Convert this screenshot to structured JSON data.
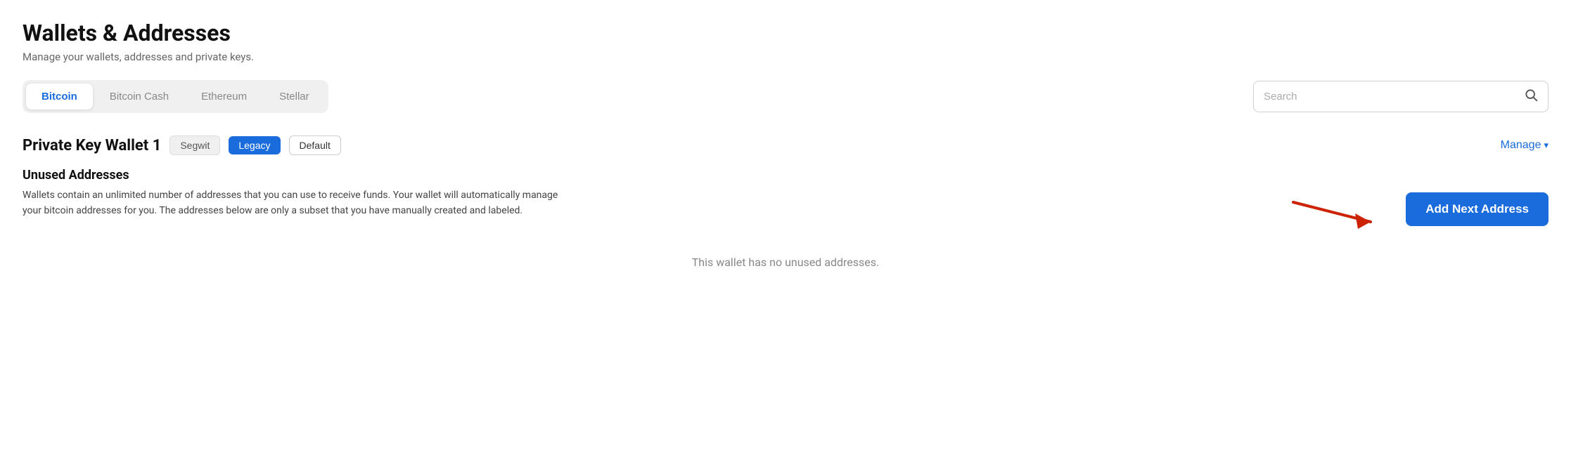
{
  "page": {
    "title": "Wallets & Addresses",
    "subtitle": "Manage your wallets, addresses and private keys."
  },
  "tabs": [
    {
      "id": "bitcoin",
      "label": "Bitcoin",
      "active": true
    },
    {
      "id": "bitcoin-cash",
      "label": "Bitcoin Cash",
      "active": false
    },
    {
      "id": "ethereum",
      "label": "Ethereum",
      "active": false
    },
    {
      "id": "stellar",
      "label": "Stellar",
      "active": false
    }
  ],
  "search": {
    "placeholder": "Search"
  },
  "wallet": {
    "name": "Private Key Wallet 1",
    "badges": [
      {
        "id": "segwit",
        "label": "Segwit",
        "style": "segwit"
      },
      {
        "id": "legacy",
        "label": "Legacy",
        "style": "legacy"
      },
      {
        "id": "default",
        "label": "Default",
        "style": "default"
      }
    ],
    "manage_label": "Manage"
  },
  "unused_addresses": {
    "title": "Unused Addresses",
    "description": "Wallets contain an unlimited number of addresses that you can use to receive funds. Your wallet will automatically manage your bitcoin addresses for you. The addresses below are only a subset that you have manually created and labeled.",
    "empty_message": "This wallet has no unused addresses.",
    "add_button_label": "Add Next Address"
  }
}
